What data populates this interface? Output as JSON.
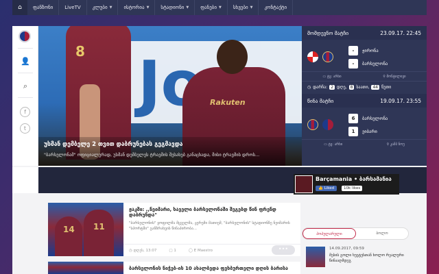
{
  "nav": {
    "home_icon": "home-icon",
    "items": [
      {
        "label": "ფანზონი",
        "dropdown": false
      },
      {
        "label": "LiveTV",
        "dropdown": false
      },
      {
        "label": "კლუბი",
        "dropdown": true
      },
      {
        "label": "ისტორია",
        "dropdown": true
      },
      {
        "label": "სტადიონი",
        "dropdown": true
      },
      {
        "label": "ფანები",
        "dropdown": true
      },
      {
        "label": "სხვები",
        "dropdown": true
      },
      {
        "label": "კონტაქტი",
        "dropdown": false
      }
    ],
    "dropdown_glyph": "▼"
  },
  "hero": {
    "sign_text": "Jo",
    "player_number": "8",
    "shirt_brand": "Rakuten",
    "title": "უსმან დემბელე 2 თვით დაბრუნებას გეგმავდა",
    "snippet": "\"ბარსელონამ\" ოფიციალურად, უსმან დემბელეს ტრავმის შესახებ განაცხადა, მისი ტრავმის დროს..."
  },
  "match": {
    "next": {
      "title": "მომდევნო მატჩი",
      "datetime": "23.09.17. 22:45",
      "home": {
        "name": "ჟირონა",
        "score": "-"
      },
      "away": {
        "name": "ბარსელონა",
        "score": "-"
      },
      "tv": "ტვ: არხი",
      "venue": "მონტილივი",
      "countdown_label": "დარჩა:",
      "days_num": "2",
      "days_label": "დღე,",
      "hours_num": "8",
      "hours_label": "საათი,",
      "minutes_num": "44",
      "minutes_label": "წუთი"
    },
    "prev": {
      "title": "წინა მატჩი",
      "datetime": "19.09.17. 23:55",
      "home": {
        "name": "ბარსელონა",
        "score": "6"
      },
      "away": {
        "name": "ეიბარი",
        "score": "1"
      },
      "tv": "ტვ: არხი",
      "venue": "კამპ ნოუ"
    }
  },
  "news": [
    {
      "title": "ჟაკში: ,,ნეიმარი, ხაველი ბარსელონაში შეგებდ წინ ფრენდ დაბრუნდა\"",
      "snippet": "\"ბარსელონის\" ყოფილმა მცველმა, ჟერემი მათიემ, \"ბარსელონის\" სტადიონზე ნეიმარის \"სპორტში\" განზრახვის წინაპირობა...",
      "date": "დღეს, 13:07",
      "comments": "1",
      "author": "E Maestro",
      "more": "•••"
    },
    {
      "title": "ბარსელონის ნიჭებ-ის 10 ახალბედა ფეხბურთელი დღის ბარისა",
      "snippet": "",
      "date": "",
      "comments": "",
      "author": "",
      "more": ""
    }
  ],
  "facebook": {
    "name": "Barçamania • ბარსამანია",
    "like_label": "Liked",
    "likes": "10k likes"
  },
  "sidebar_tabs": {
    "popular": "პოპულარული",
    "latest": "ბოლო"
  },
  "popular_item": {
    "date": "14.09.2017, 09:59",
    "title": "მესის გოლი ხუეტუსთან ხოლო რეალური წინააღმდეგ"
  }
}
